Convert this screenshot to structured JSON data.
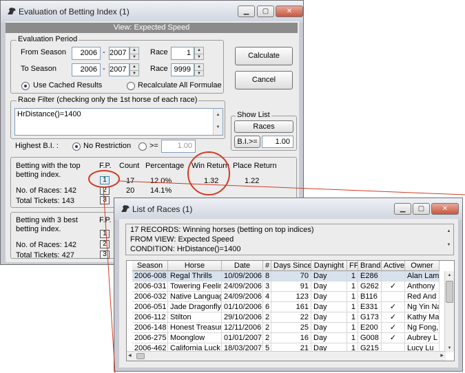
{
  "main_window": {
    "title": "Evaluation of Betting Index (1)",
    "view_bar": "View: Expected Speed",
    "evaluation_period": {
      "group_label": "Evaluation Period",
      "from_season_label": "From Season",
      "from_season_start": "2006",
      "from_season_end": "2007",
      "to_season_label": "To Season",
      "to_season_start": "2006",
      "to_season_end": "2007",
      "race_label_1": "Race",
      "race_from": "1",
      "race_label_2": "Race",
      "race_to": "9999",
      "dash": "-",
      "use_cached_label": "Use Cached Results",
      "recalc_label": "Recalculate All Formulae"
    },
    "calculate_label": "Calculate",
    "cancel_label": "Cancel",
    "race_filter": {
      "group_label": "Race Filter (checking only the 1st horse of each race)",
      "text": "HrDistance()=1400"
    },
    "show_list": {
      "group_label": "Show List",
      "races_label": "Races",
      "bi_label": "B.I.>=",
      "bi_value": "1.00"
    },
    "highest_bi": {
      "label": "Highest B.I. :",
      "no_restriction_label": "No Restriction",
      "gte_label": ">=",
      "gte_value": "1.00"
    },
    "results_top": {
      "title_line1": "Betting with the top",
      "title_line2": "betting index.",
      "col_fp": "F.P.",
      "col_count": "Count",
      "col_percentage": "Percentage",
      "col_win_return": "Win Return",
      "col_place_return": "Place Return",
      "no_races_label": "No. of Races: 142",
      "total_tickets_label": "Total Tickets:  143",
      "rows": [
        {
          "fp": "1",
          "count": "17",
          "percentage": "12.0%",
          "win_return": "1.32",
          "place_return": "1.22"
        },
        {
          "fp": "2",
          "count": "20",
          "percentage": "14.1%",
          "win_return": "",
          "place_return": ""
        },
        {
          "fp": "3",
          "count": "",
          "percentage": "",
          "win_return": "",
          "place_return": ""
        }
      ]
    },
    "results_best3": {
      "title_line1": "Betting with 3 best",
      "title_line2": "betting index.",
      "col_fp": "F.P.",
      "no_races_label": "No. of Races: 142",
      "total_tickets_label": "Total Tickets:  427",
      "fps": [
        "1",
        "2",
        "3"
      ]
    }
  },
  "list_window": {
    "title": "List of Races (1)",
    "info_line1": "17 RECORDS: Winning horses (betting on top indices)",
    "info_line2": "FROM VIEW: Expected Speed",
    "info_line3": "CONDITION: HrDistance()=1400",
    "columns": [
      "Season",
      "Horse",
      "Date",
      "#",
      "Days Since",
      "Daynight",
      "FP",
      "Brand",
      "Active",
      "Owner"
    ],
    "rows": [
      [
        "2006-008",
        "Regal Thrills",
        "10/09/2006",
        "8",
        "70",
        "Day",
        "1",
        "E286",
        "",
        "Alan Lam"
      ],
      [
        "2006-031",
        "Towering Feeling",
        "24/09/2006",
        "3",
        "91",
        "Day",
        "1",
        "G262",
        "✓",
        "Anthony"
      ],
      [
        "2006-032",
        "Native Language",
        "24/09/2006",
        "4",
        "123",
        "Day",
        "1",
        "B116",
        "",
        "Red And"
      ],
      [
        "2006-051",
        "Jade Dragonfly",
        "01/10/2006",
        "6",
        "161",
        "Day",
        "1",
        "E331",
        "✓",
        "Ng Yin Na"
      ],
      [
        "2006-112",
        "Stilton",
        "29/10/2006",
        "2",
        "22",
        "Day",
        "1",
        "G173",
        "✓",
        "Kathy Ma"
      ],
      [
        "2006-148",
        "Honest Treasure",
        "12/11/2006",
        "2",
        "25",
        "Day",
        "1",
        "E200",
        "✓",
        "Ng Fong,"
      ],
      [
        "2006-275",
        "Moonglow",
        "01/01/2007",
        "2",
        "16",
        "Day",
        "1",
        "G008",
        "✓",
        "Aubrey L"
      ],
      [
        "2006-462",
        "California Luck",
        "18/03/2007",
        "5",
        "21",
        "Day",
        "1",
        "G215",
        "",
        "Lucy Lu"
      ]
    ]
  },
  "colors": {
    "annotation": "#d23a24",
    "selected_row": "#d8e2ee"
  }
}
